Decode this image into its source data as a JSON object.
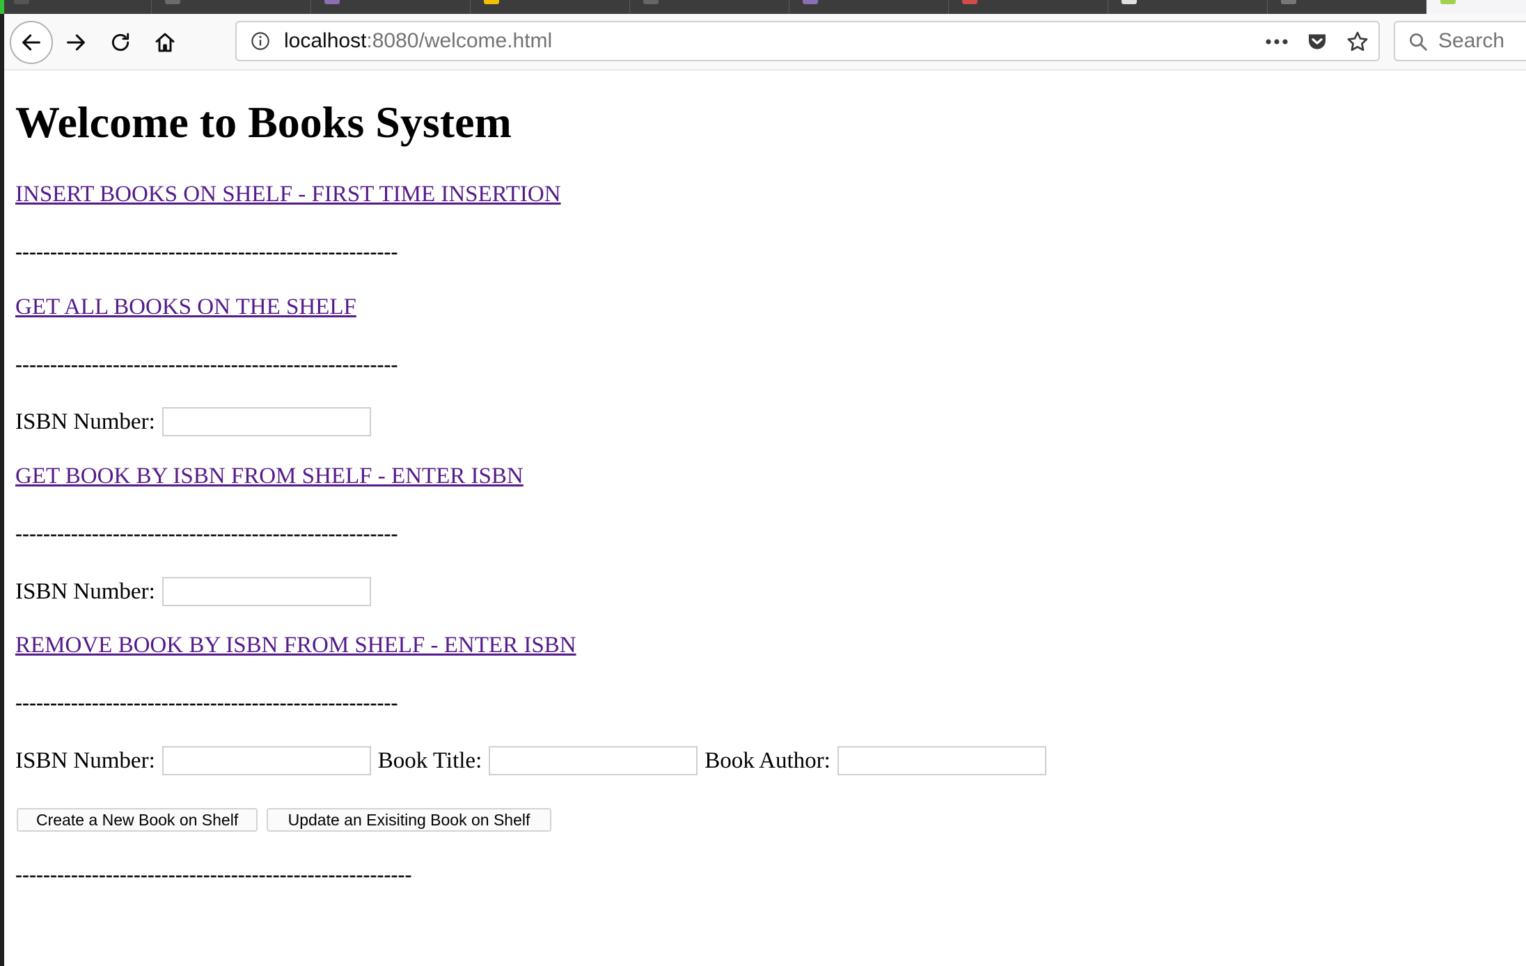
{
  "browser": {
    "url_host": "localhost",
    "url_rest": ":8080/welcome.html",
    "search_placeholder": "Search",
    "icons": {
      "back": "back-arrow-icon",
      "forward": "forward-arrow-icon",
      "reload": "reload-icon",
      "home": "home-icon",
      "info": "info-icon",
      "more": "more-dots-icon",
      "pocket": "pocket-icon",
      "bookmark": "star-icon",
      "search": "search-icon"
    },
    "tab_favicon_colors": [
      "#8a6fb5",
      "#c94a4a",
      "#f2c200",
      "#d24b4b",
      "#e0e0e0"
    ]
  },
  "page": {
    "title": "Welcome to Books System",
    "separator": "-------------------------------------------------------",
    "separator_long": "---------------------------------------------------------",
    "insert_link": "INSERT BOOKS ON SHELF - FIRST TIME INSERTION",
    "get_all_link": "GET ALL BOOKS ON THE SHELF",
    "isbn_label": "ISBN Number:",
    "get_by_isbn_link": "GET BOOK BY ISBN FROM SHELF - ENTER ISBN",
    "remove_by_isbn_link": "REMOVE BOOK BY ISBN FROM SHELF - ENTER ISBN",
    "book_title_label": "Book Title:",
    "book_author_label": "Book Author:",
    "create_button": "Create a New Book on Shelf",
    "update_button": "Update an Exisiting Book on Shelf",
    "link_color": "#551a8b"
  }
}
